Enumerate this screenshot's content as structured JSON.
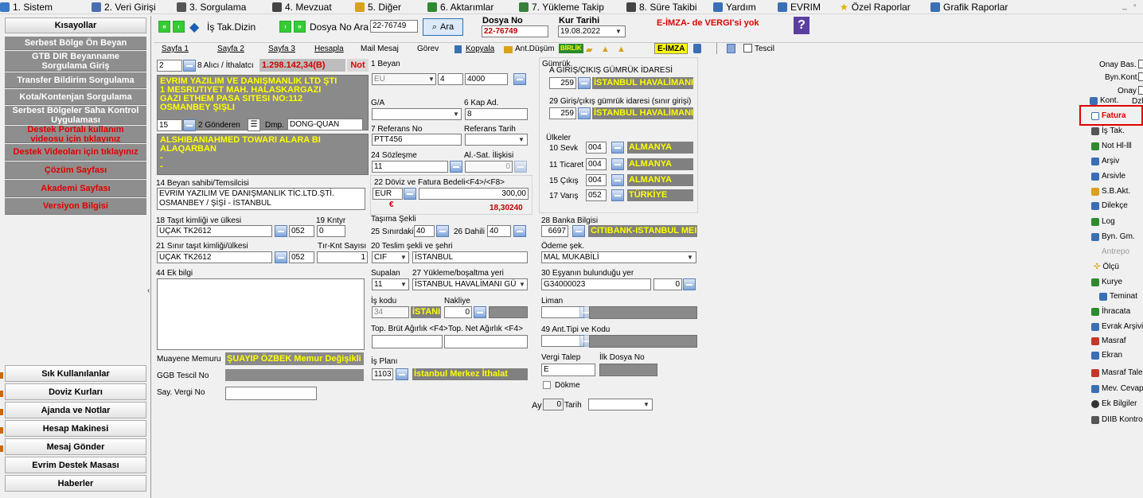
{
  "menu": [
    {
      "label": "1. Sistem",
      "icon": "system-icon",
      "color": "#3a78c8"
    },
    {
      "label": "2. Veri Girişi",
      "icon": "data-entry-icon",
      "color": "#4a6fb0"
    },
    {
      "label": "3. Sorgulama",
      "icon": "query-icon",
      "color": "#555555"
    },
    {
      "label": "4. Mevzuat",
      "icon": "legislation-icon",
      "color": "#444444"
    },
    {
      "label": "5. Diğer",
      "icon": "other-icon",
      "color": "#d9a21b"
    },
    {
      "label": "6. Aktarımlar",
      "icon": "transfer-icon",
      "color": "#2f8a2f"
    },
    {
      "label": "7. Yükleme Takip",
      "icon": "loading-track-icon",
      "color": "#3a7f3a"
    },
    {
      "label": "8. Süre Takibi",
      "icon": "time-track-icon",
      "color": "#444444"
    },
    {
      "label": "Yardım",
      "icon": "help-icon",
      "color": "#3b6fb5"
    },
    {
      "label": "EVRIM",
      "icon": "evrim-icon",
      "color": "#3b6fb5"
    },
    {
      "label": "Özel Raporlar",
      "icon": "star-icon",
      "color": "#e0b000"
    },
    {
      "label": "Grafik Raporlar",
      "icon": "chart-icon",
      "color": "#3b6fb5"
    }
  ],
  "window_controls": {
    "minimize": "_",
    "restore": "▫"
  },
  "sidebar": {
    "header": "Kısayollar",
    "items": [
      {
        "label": "Serbest Bölge Ön Beyan",
        "red": false
      },
      {
        "label": "GTB DIR Beyanname Sorgulama Giriş",
        "red": false
      },
      {
        "label": "Transfer Bildirim Sorgulama",
        "red": false
      },
      {
        "label": "Kota/Kontenjan Sorgulama",
        "red": false
      },
      {
        "label": "Serbest Bölgeler Saha Kontrol Uygulaması",
        "red": false
      },
      {
        "label": "Destek Portalı kullanım videosu için tıklayınız",
        "red": true
      },
      {
        "label": "Destek Videoları için tıklayınız",
        "red": true
      },
      {
        "label": "Çözüm Sayfası",
        "red": true
      },
      {
        "label": "Akademi Sayfası",
        "red": true
      },
      {
        "label": "Versiyon Bilgisi",
        "red": true
      }
    ],
    "bottom": [
      "Sık Kullanılanlar",
      "Doviz Kurları",
      "Ajanda ve Notlar",
      "Hesap Makinesi",
      "Mesaj Gönder",
      "Evrim Destek Masası",
      "Haberler"
    ],
    "collapse_arrow": "‹"
  },
  "toolbar": {
    "is_tak_dizin": "İş Tak.Dizin",
    "dosya_no_ara_label": "Dosya No Ara",
    "dosya_no_ara_value": "22-76749",
    "ara_button": "Ara",
    "dosya_no_header": "Dosya No",
    "dosya_no_value": "22-76749",
    "kur_tarihi_header": "Kur Tarihi",
    "kur_tarihi_value": "19.08.2022",
    "eimza_warning": "E-İMZA- de VERGI'si yok",
    "question": "?"
  },
  "tabs": [
    "Sayfa 1",
    "Sayfa 2",
    "Sayfa 3",
    "Hesapla",
    "Mail Mesaj",
    "Görev",
    "Kopyala",
    "Ant.Düşüm"
  ],
  "tab_badges": {
    "birlik": "BİRLİK",
    "eimza": "E-İMZA",
    "tescil": "Tescil"
  },
  "form": {
    "alici_num": "2",
    "alici_label": "8 Alıcı / İthalatcı",
    "amount": "1.298.142,34(B)",
    "not_label": "Not",
    "alici_text": [
      "EVRIM YAZILIM VE DANIŞMANLIK LTD ŞTI",
      "1 MESRUTIYET MAH. HALASKARGAZI",
      "GAZI ETHEM PASA SITESI NO:112",
      "OSMANBEY ŞIŞLI"
    ],
    "gonderen_num": "15",
    "gonderen_label": "2 Gönderen",
    "dmp_label": "Dmp.",
    "dmp_value": "DONG-QUAN",
    "gonderen_text": [
      "ALSHIBANIAHMED TOWARI  ALARA BI",
      "ALAQARBAN",
      "-",
      "-"
    ],
    "beyan_sahibi_label": "14 Beyan sahibi/Temsilcisi",
    "beyan_sahibi_text": [
      "EVRIM YAZILIM VE DANIŞMANLIK TİC.LTD.ŞTİ.",
      "OSMANBEY / ŞİŞİ - İSTANBUL"
    ],
    "tasit_label": "18 Taşıt kimliği ve ülkesi",
    "tasit_value": "UÇAK TK2612",
    "tasit_code": "052",
    "kntyr_label": "19 Kntyr",
    "kntyr_value": "0",
    "sinir_tasit_label": "21 Sınır taşıt kimliği/ülkesi",
    "sinir_tasit_value": "UÇAK TK2612",
    "sinir_code": "052",
    "tir_label": "Tır-Knt Sayısı",
    "tir_value": "1",
    "ek_bilgi_label": "44 Ek bilgi",
    "muayene_label": "Muayene Memuru",
    "muayene_value": "ŞUAYIP ÖZBEK  Memur Değişikli",
    "ggb_label": "GGB Tescil No",
    "say_vergi_label": "Say. Vergi No",
    "beyan_label": "1 Beyan",
    "beyan_a": "EU",
    "beyan_b": "4",
    "beyan_c": "4000",
    "ga_label": "G/A",
    "kap_label": "6 Kap Ad.",
    "kap_value": "8",
    "referans_label": "7 Referans No",
    "referans_value": "PTT456",
    "ref_tarih_label": "Referans Tarih",
    "sozlesme_label": "24 Sözleşme",
    "sozlesme_value": "11",
    "alsat_label": "Al.-Sat. İlişkisi",
    "alsat_value": "0",
    "doviz_label": "22 Döviz ve Fatura Bedeli<F4>/<F8>",
    "doviz_code": "EUR",
    "doviz_amount": "300,00",
    "doviz_symbol": "€",
    "doviz_rate": "18,30240",
    "tasima_label": "Taşıma Şekli",
    "sinirdaki_label": "25 Sınırdaki",
    "sinirdaki_value": "40",
    "dahili_label": "26 Dahili",
    "dahili_value": "40",
    "teslim_label": "20 Teslim şekli ve şehri",
    "teslim_code": "CIF",
    "teslim_city": "İSTANBUL",
    "supalan_label": "Supalan",
    "supalan_value": "11",
    "yukleme_label": "27 Yükleme/boşaltma yeri",
    "yukleme_value": "İSTANBUL HAVALİMANI GÜ",
    "iskodu_label": "İş kodu",
    "iskodu_value": "34",
    "iskodu_name": "İSTANI",
    "nakliye_label": "Nakliye",
    "nakliye_value": "0",
    "brut_label": "Top. Brüt Ağırlık <F4>",
    "net_label": "Top. Net Ağırlık <F4>",
    "isplani_label": "İş Planı",
    "isplani_value": "1103",
    "isplani_name": "İstanbul Merkez İthalat",
    "gumruk_label": "Gümrük",
    "giris_label": "A GİRİŞ/ÇIKIŞ GÜMRÜK İDARESİ",
    "giris_code": "259",
    "giris_name": "İSTANBUL HAVALİMANI",
    "giris29_label": "29 Giriş/çıkış gümrük idaresi (sınır girişi)",
    "giris29_code": "259",
    "giris29_name": "İSTANBUL HAVALİMANI",
    "ulkeler_label": "Ülkeler",
    "ulkeler": [
      {
        "label": "10 Sevk",
        "code": "004",
        "name": "ALMANYA"
      },
      {
        "label": "11 Ticaret",
        "code": "004",
        "name": "ALMANYA"
      },
      {
        "label": "15 Çıkış",
        "code": "004",
        "name": "ALMANYA"
      },
      {
        "label": "17 Varış",
        "code": "052",
        "name": "TÜRKİYE"
      }
    ],
    "banka_label": "28 Banka Bilgisi",
    "banka_code": "6697",
    "banka_name": "CITIBANK-ISTANBUL MEI",
    "odeme_label": "Ödeme şek.",
    "odeme_value": "MAL MUKABİLİ",
    "esya_label": "30 Eşyanın bulunduğu yer",
    "esya_value": "G34000023",
    "esya_num": "0",
    "liman_label": "Liman",
    "ant_tipi_label": "49 Ant.Tipi ve Kodu",
    "vergi_talep_label": "Vergi Talep",
    "vergi_talep_value": "E",
    "ilk_dosya_label": "İlk Dosya No",
    "dokme_label": "Dökme",
    "ay_label": "Ay",
    "ay_value": "0",
    "tarih_label": "Tarih"
  },
  "right_panel": {
    "onay_bas": "Onay Bas.",
    "byn_kont": "Byn.Kont.",
    "onay": "Onay",
    "kont": "Kont.",
    "dzl": "Dzl",
    "items": [
      "Fatura",
      "İş Tak.",
      "Not Hl-lll",
      "Arşiv",
      "Arsivle",
      "S.B.Akt.",
      "Dilekçe",
      "Log",
      "Byn. Gm.",
      "Antrepo",
      "Ölçü",
      "Kurye",
      "Teminat",
      "İhracata",
      "Evrak Arşivi",
      "Masraf",
      "Ekran",
      "Masraf Talep",
      "Mev. Cevap",
      "Ek Bilgiler",
      "DIIB Kontrol"
    ]
  }
}
